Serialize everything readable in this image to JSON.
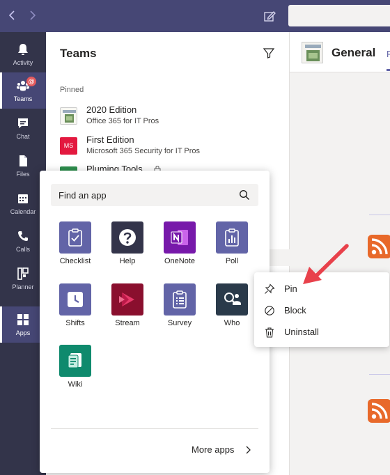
{
  "appbar": {
    "items": [
      {
        "label": "Activity"
      },
      {
        "label": "Teams",
        "badge": "@"
      },
      {
        "label": "Chat"
      },
      {
        "label": "Files"
      },
      {
        "label": "Calendar"
      },
      {
        "label": "Calls"
      },
      {
        "label": "Planner"
      },
      {
        "label": "Apps"
      }
    ]
  },
  "teams_panel": {
    "title": "Teams",
    "pinned_label": "Pinned",
    "teams": [
      {
        "name": "2020 Edition",
        "subtitle": "Office 365 for IT Pros"
      },
      {
        "name": "First Edition",
        "subtitle": "Microsoft 365 Security for IT Pros",
        "thumb_text": "MS"
      },
      {
        "name": "Pluming Tools"
      }
    ],
    "more_dots": "..."
  },
  "channel": {
    "title": "General",
    "tab_partial": "P"
  },
  "apps_flyout": {
    "search_placeholder": "Find an app",
    "apps": [
      {
        "label": "Checklist",
        "icon": "checklist-icon",
        "color": "#6264a7"
      },
      {
        "label": "Help",
        "icon": "help-icon",
        "color": "#33344a"
      },
      {
        "label": "OneNote",
        "icon": "onenote-icon",
        "color": "#7719aa"
      },
      {
        "label": "Poll",
        "icon": "poll-icon",
        "color": "#6264a7"
      },
      {
        "label": "Shifts",
        "icon": "shifts-icon",
        "color": "#6264a7"
      },
      {
        "label": "Stream",
        "icon": "stream-icon",
        "color": "#8a0f2e"
      },
      {
        "label": "Survey",
        "icon": "survey-icon",
        "color": "#6264a7"
      },
      {
        "label": "Who",
        "icon": "who-icon",
        "color": "#2a3a4a"
      },
      {
        "label": "Wiki",
        "icon": "wiki-icon",
        "color": "#0f8a6d"
      }
    ],
    "more_apps": "More apps"
  },
  "context_menu": {
    "items": [
      {
        "label": "Pin",
        "icon": "pin-icon"
      },
      {
        "label": "Block",
        "icon": "block-icon"
      },
      {
        "label": "Uninstall",
        "icon": "trash-icon"
      }
    ]
  },
  "colors": {
    "titlebar": "#464775",
    "appbar": "#33344a",
    "accent": "#6264a7",
    "annotation_arrow": "#e8414b",
    "rss": "#e8692a"
  }
}
